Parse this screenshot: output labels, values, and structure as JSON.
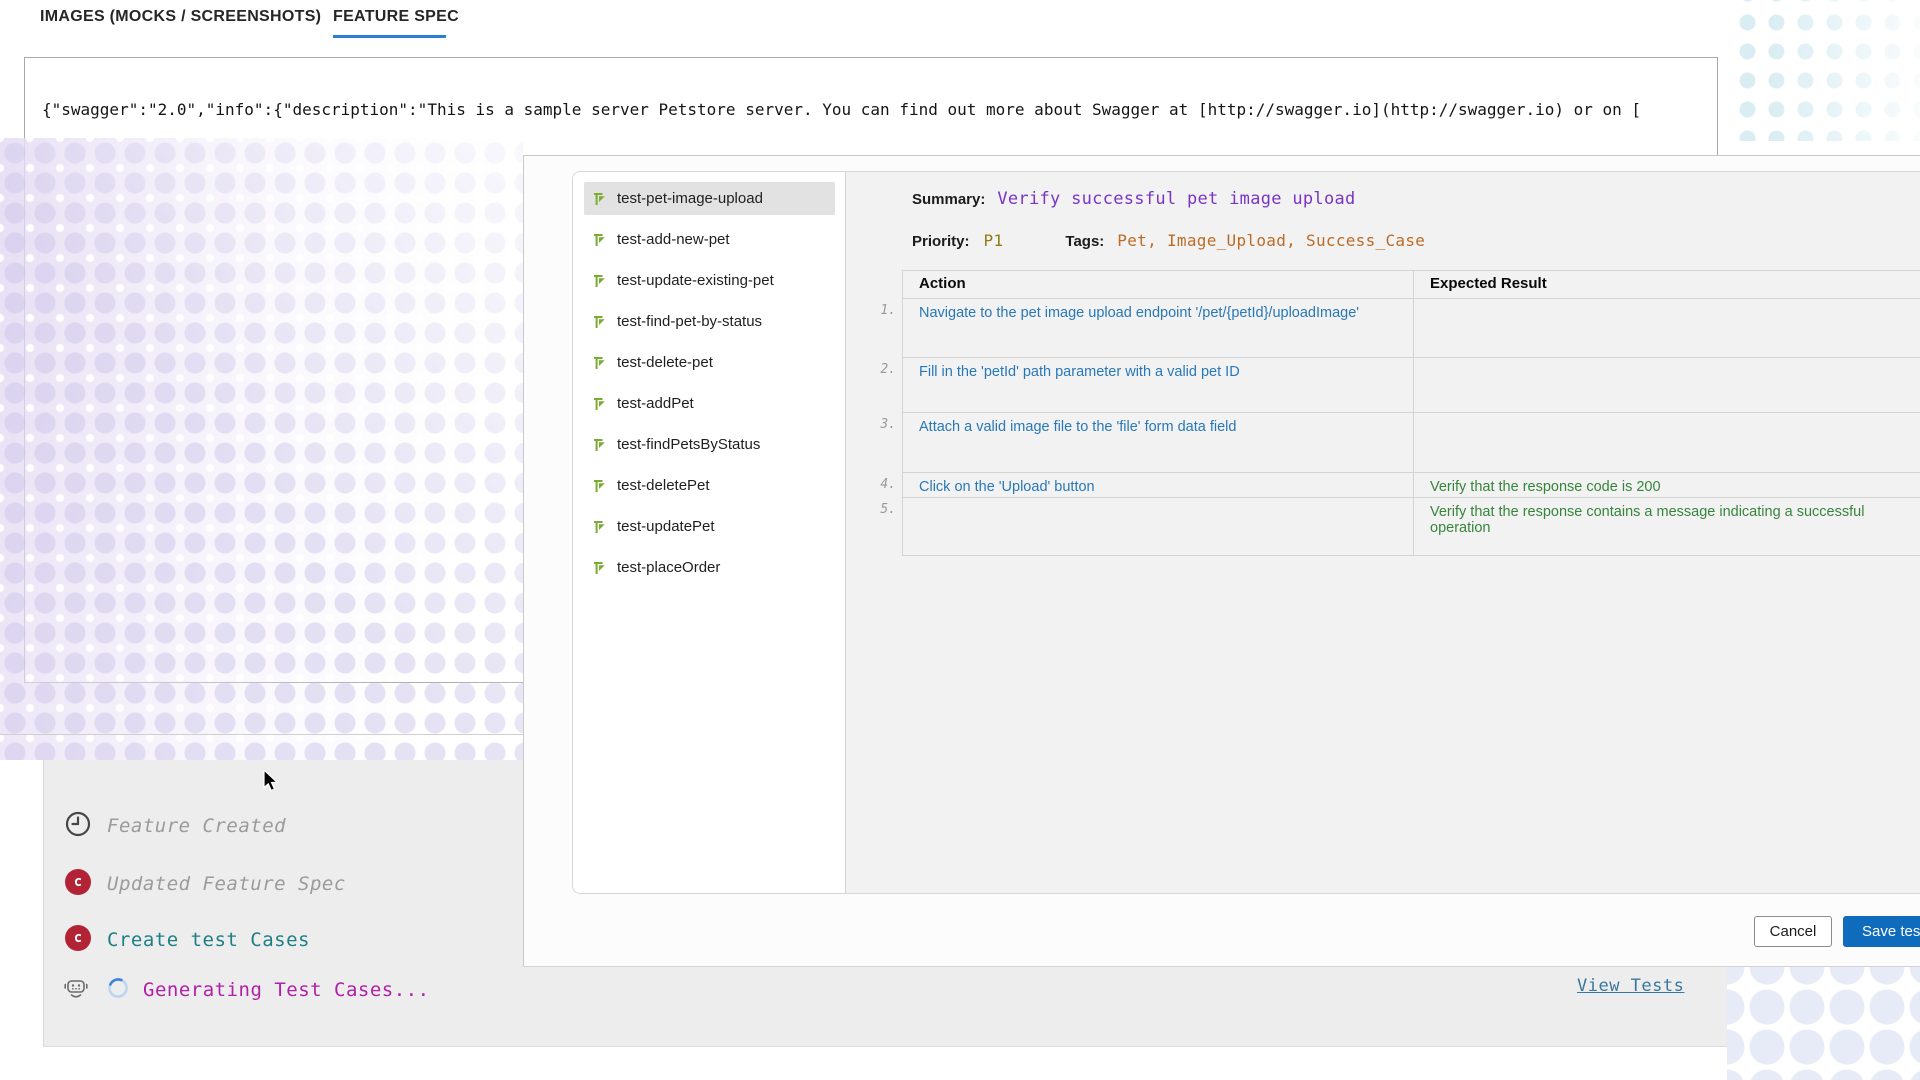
{
  "tabs": {
    "images_label": "IMAGES (MOCKS / SCREENSHOTS)",
    "feature_label": "FEATURE SPEC"
  },
  "spec_preview": "{\"swagger\":\"2.0\",\"info\":{\"description\":\"This is a sample server Petstore server.  You can find out more about Swagger at [http://swagger.io](http://swagger.io) or on [",
  "test_list": {
    "items": [
      {
        "label": "test-pet-image-upload",
        "selected": true
      },
      {
        "label": "test-add-new-pet",
        "selected": false
      },
      {
        "label": "test-update-existing-pet",
        "selected": false
      },
      {
        "label": "test-find-pet-by-status",
        "selected": false
      },
      {
        "label": "test-delete-pet",
        "selected": false
      },
      {
        "label": "test-addPet",
        "selected": false
      },
      {
        "label": "test-findPetsByStatus",
        "selected": false
      },
      {
        "label": "test-deletePet",
        "selected": false
      },
      {
        "label": "test-updatePet",
        "selected": false
      },
      {
        "label": "test-placeOrder",
        "selected": false
      }
    ]
  },
  "detail": {
    "summary_label": "Summary:",
    "summary_value": "Verify successful pet image upload",
    "priority_label": "Priority:",
    "priority_value": "P1",
    "tags_label": "Tags:",
    "tags_value": "Pet, Image_Upload, Success_Case",
    "table": {
      "headers": [
        "Action",
        "Expected Result"
      ],
      "rows": [
        {
          "num": "1.",
          "action": "Navigate to the pet image upload endpoint '/pet/{petId}/uploadImage'",
          "expected": ""
        },
        {
          "num": "2.",
          "action": "Fill in the 'petId' path parameter with a valid pet ID",
          "expected": ""
        },
        {
          "num": "3.",
          "action": "Attach a valid image file to the 'file' form data field",
          "expected": ""
        },
        {
          "num": "4.",
          "action": "Click on the 'Upload' button",
          "expected": "Verify that the response code is 200"
        },
        {
          "num": "5.",
          "action": "",
          "expected": "Verify that the response contains a message indicating a successful operation"
        }
      ]
    }
  },
  "footer": {
    "cancel_label": "Cancel",
    "save_label": "Save tests",
    "view_tests_label": "View Tests"
  },
  "timeline": {
    "badge_letter": "c",
    "items": [
      {
        "label": "Feature Created",
        "icon": "clock-icon",
        "style": "muted"
      },
      {
        "label": "Updated Feature Spec",
        "icon": "agent-badge",
        "style": "muted"
      },
      {
        "label": "Create test Cases",
        "icon": "agent-badge",
        "style": "teal"
      },
      {
        "label": "Generating Test Cases...",
        "icon": "robot-and-spinner",
        "style": "magenta"
      }
    ]
  },
  "colors": {
    "tab_underline": "#2a7fd4",
    "save_button": "#0f6cbd",
    "action_text": "#2878b8",
    "expected_text": "#37853c",
    "summary_value": "#7a35c4",
    "priority_value": "#8f7c13",
    "tags_value": "#bd6b26",
    "timeline_teal": "#1c7f85",
    "timeline_magenta": "#b01fa8",
    "badge_red": "#b12335",
    "test_flag_green": "#7aab33",
    "view_tests_link": "#38789f"
  }
}
